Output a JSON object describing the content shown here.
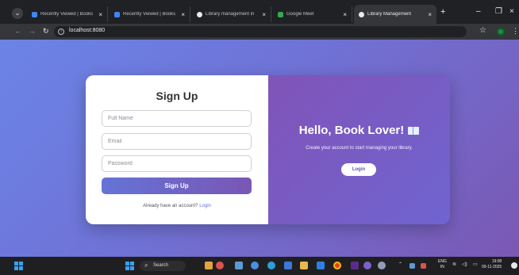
{
  "browser": {
    "tabs": [
      {
        "title": "Recently Viewed | Books",
        "color": "#4285f4"
      },
      {
        "title": "Recently Viewed | Books",
        "color": "#4285f4"
      },
      {
        "title": "Library management in",
        "color": "#e8eaed"
      },
      {
        "title": "Google Meet",
        "color": "#34a853"
      },
      {
        "title": "Library Management",
        "color": "#e8eaed",
        "active": true
      }
    ],
    "url": "localhost:8080"
  },
  "signup": {
    "title": "Sign Up",
    "full_name_placeholder": "Full Name",
    "email_placeholder": "Email",
    "password_placeholder": "Password",
    "submit_label": "Sign Up",
    "have_account_text": "Already have an account?",
    "login_link": "Login"
  },
  "welcome": {
    "heading": "Hello, Book Lover!",
    "tagline": "Create your account to start managing your library.",
    "login_button": "Login"
  },
  "taskbar": {
    "search_label": "Search",
    "lang_line1": "ENG",
    "lang_line2": "IN",
    "time": "19:08",
    "date": "09-11-2025"
  },
  "colors": {
    "page_gradient": [
      "#6b84e6",
      "#7a58b4"
    ],
    "panel_gradient": [
      "#8054b8",
      "#7064d0"
    ],
    "button_gradient": [
      "#6474d6",
      "#7a56b4"
    ]
  }
}
